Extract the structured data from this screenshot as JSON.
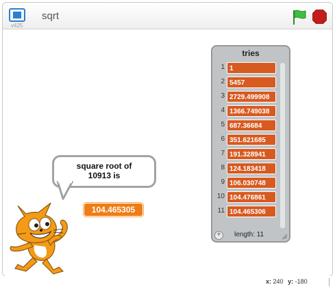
{
  "header": {
    "version": "v425",
    "title": "sqrt",
    "fullscreen_icon": "fullscreen-icon",
    "flag_icon": "green-flag-icon",
    "stop_icon": "stop-sign-icon",
    "flag_color": "#2ea42e",
    "stop_color": "#c41b1b"
  },
  "list_monitor": {
    "title": "tries",
    "items": [
      {
        "index": "1",
        "value": "1"
      },
      {
        "index": "2",
        "value": "5457"
      },
      {
        "index": "3",
        "value": "2729.499908"
      },
      {
        "index": "4",
        "value": "1366.749038"
      },
      {
        "index": "5",
        "value": "687.36684"
      },
      {
        "index": "6",
        "value": "351.621685"
      },
      {
        "index": "7",
        "value": "191.328941"
      },
      {
        "index": "8",
        "value": "124.183418"
      },
      {
        "index": "9",
        "value": "106.030748"
      },
      {
        "index": "10",
        "value": "104.476861"
      },
      {
        "index": "11",
        "value": "104.465306"
      }
    ],
    "add_label": "+",
    "length_label": "length: 11",
    "cell_color": "#d75a20"
  },
  "speech": {
    "line1": "square root of",
    "line2": "10913 is"
  },
  "variable_monitor": {
    "value": "104.465305",
    "color": "#ee7d16"
  },
  "sprite": {
    "icon": "scratch-cat-sprite"
  },
  "status": {
    "x_label": "x:",
    "x_value": "240",
    "y_label": "y:",
    "y_value": "-180"
  }
}
